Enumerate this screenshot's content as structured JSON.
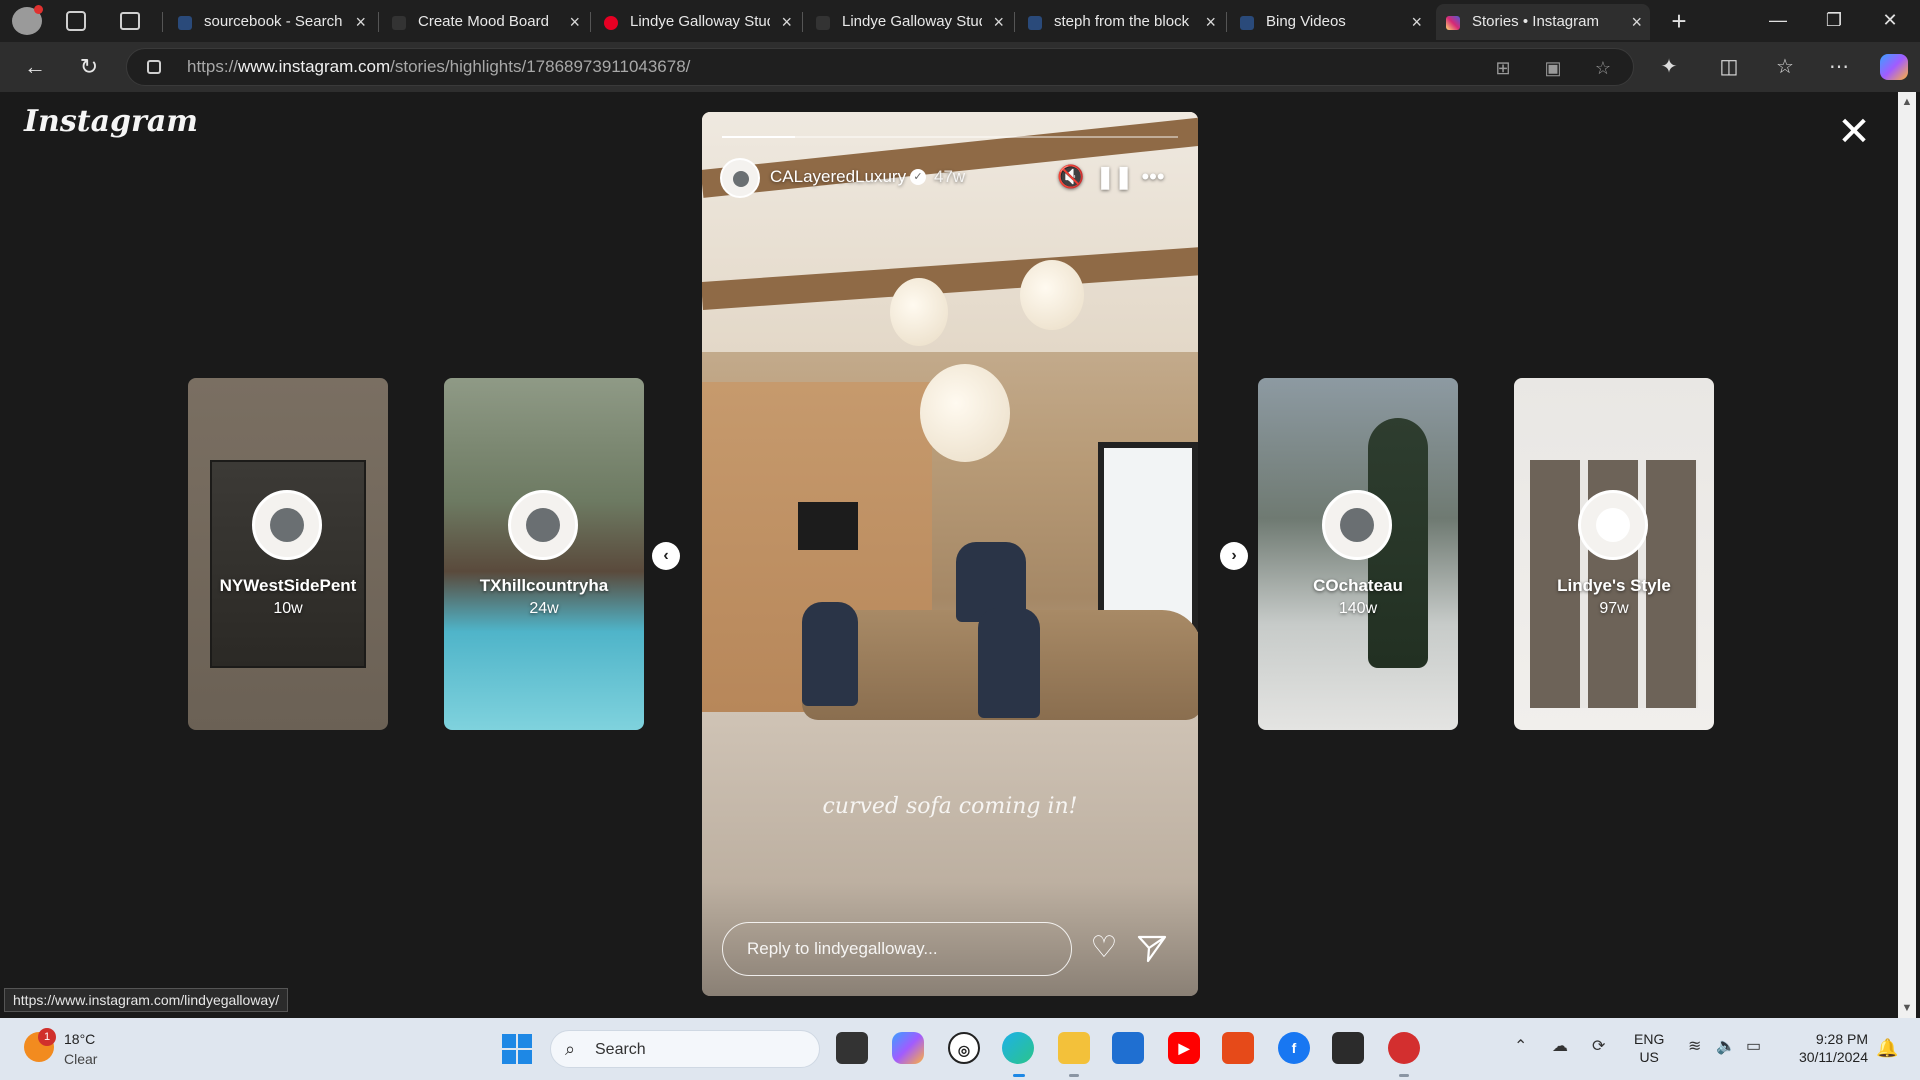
{
  "browser": {
    "tabs": [
      {
        "title": "sourcebook - Search",
        "active": false
      },
      {
        "title": "Create Mood Board",
        "active": false
      },
      {
        "title": "Lindye Galloway Stud",
        "active": false
      },
      {
        "title": "Lindye Galloway Stud",
        "active": false
      },
      {
        "title": "steph from the block",
        "active": false
      },
      {
        "title": "Bing Videos",
        "active": false
      },
      {
        "title": "Stories • Instagram",
        "active": true
      }
    ],
    "url_prefix": "https://",
    "url_host": "www.instagram.com",
    "url_path": "/stories/highlights/17868973911043678/"
  },
  "instagram": {
    "logo": "Instagram",
    "previews_left": [
      {
        "name": "NYWestSidePent",
        "age": "10w"
      },
      {
        "name": "TXhillcountryha",
        "age": "24w"
      }
    ],
    "previews_right": [
      {
        "name": "COchateau",
        "age": "140w"
      },
      {
        "name": "Lindye's Style",
        "age": "97w"
      }
    ],
    "story": {
      "username": "CALayeredLuxury",
      "verified": true,
      "age": "47w",
      "caption": "curved sofa coming in!",
      "reply_placeholder": "Reply to lindyegalloway...",
      "progress": 0.16
    },
    "status_url": "https://www.instagram.com/lindyegalloway/"
  },
  "taskbar": {
    "weather_temp": "18°C",
    "weather_cond": "Clear",
    "weather_badge": "1",
    "search_label": "Search",
    "lang_line1": "ENG",
    "lang_line2": "US",
    "time": "9:28 PM",
    "date": "30/11/2024"
  },
  "colors": {
    "viewer_bg": "#1a1a1a",
    "accent_edge": "#1e88e5",
    "instagram_text": "#ffffff"
  }
}
